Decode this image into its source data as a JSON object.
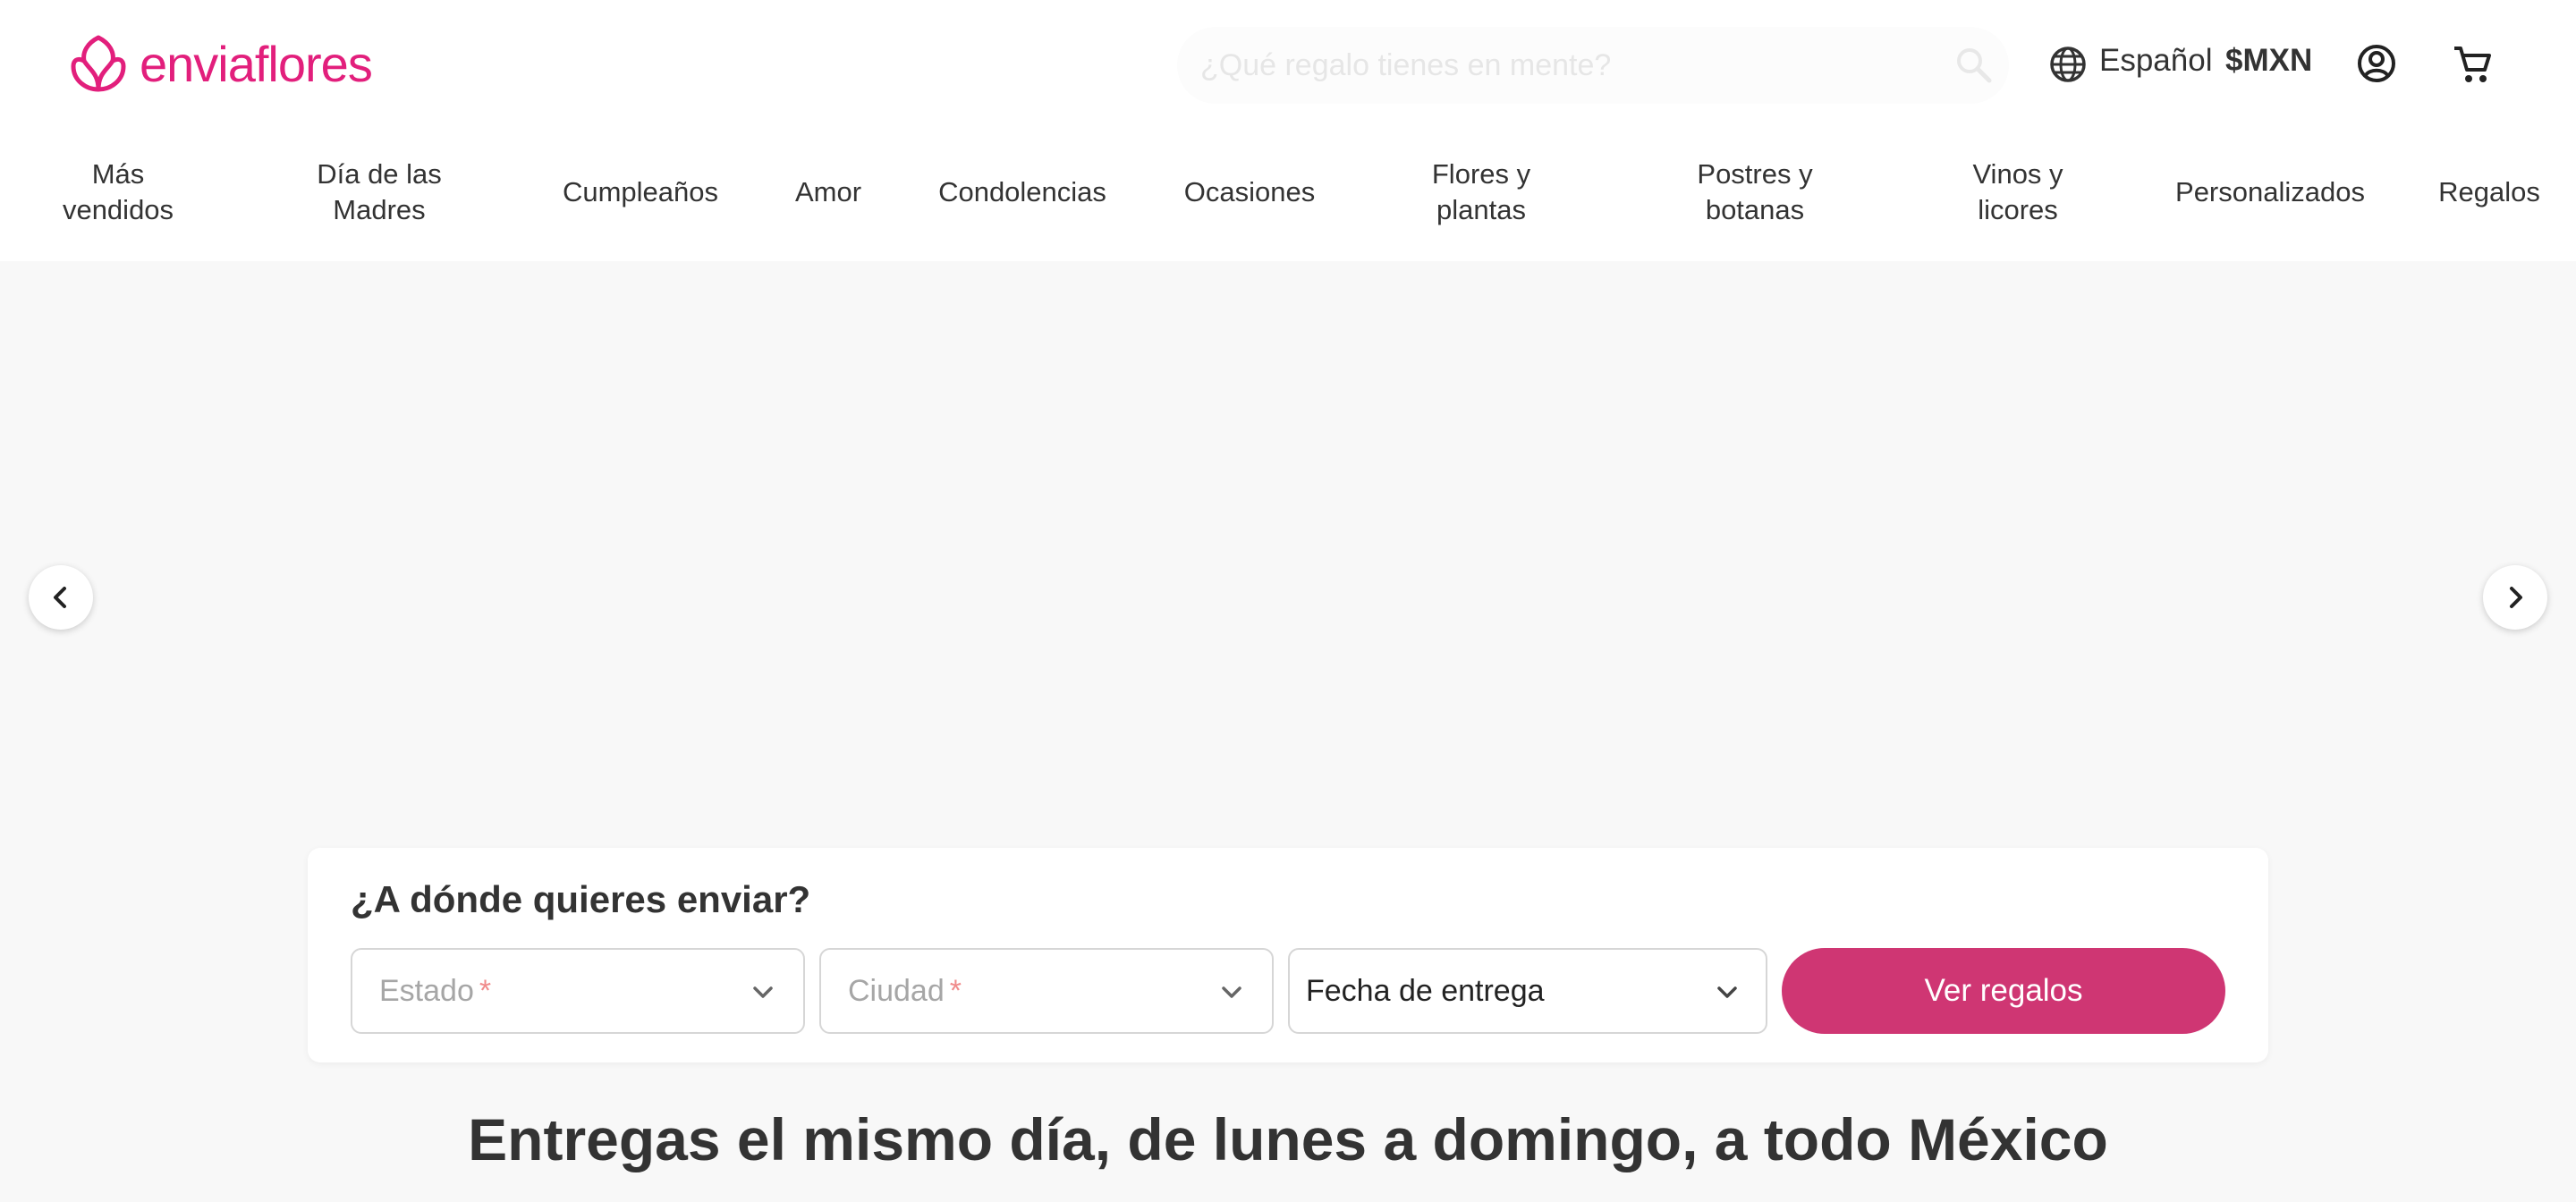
{
  "brand": {
    "name": "enviaflores",
    "color": "#e21f7c"
  },
  "header": {
    "search_placeholder": "¿Qué regalo tienes en mente?",
    "language": "Español",
    "currency": "$MXN"
  },
  "nav": {
    "items": [
      {
        "label": "Más\nvendidos"
      },
      {
        "label": "Día de las\nMadres"
      },
      {
        "label": "Cumpleaños"
      },
      {
        "label": "Amor"
      },
      {
        "label": "Condolencias"
      },
      {
        "label": "Ocasiones"
      },
      {
        "label": "Flores y\nplantas"
      },
      {
        "label": "Postres y\nbotanas"
      },
      {
        "label": "Vinos y\nlicores"
      },
      {
        "label": "Personalizados"
      },
      {
        "label": "Regalos"
      }
    ]
  },
  "delivery_form": {
    "title": "¿A dónde quieres enviar?",
    "state_label": "Estado",
    "city_label": "Ciudad",
    "required_mark": "*",
    "date_label": "Fecha de entrega",
    "submit_label": "Ver regalos",
    "accent_color": "#cf3673"
  },
  "headline": "Entregas el mismo día, de lunes a domingo, a todo México",
  "icons": [
    "logo-flower-icon",
    "search-icon",
    "globe-icon",
    "user-icon",
    "cart-icon",
    "chevron-left-icon",
    "chevron-right-icon",
    "chevron-down-icon"
  ]
}
